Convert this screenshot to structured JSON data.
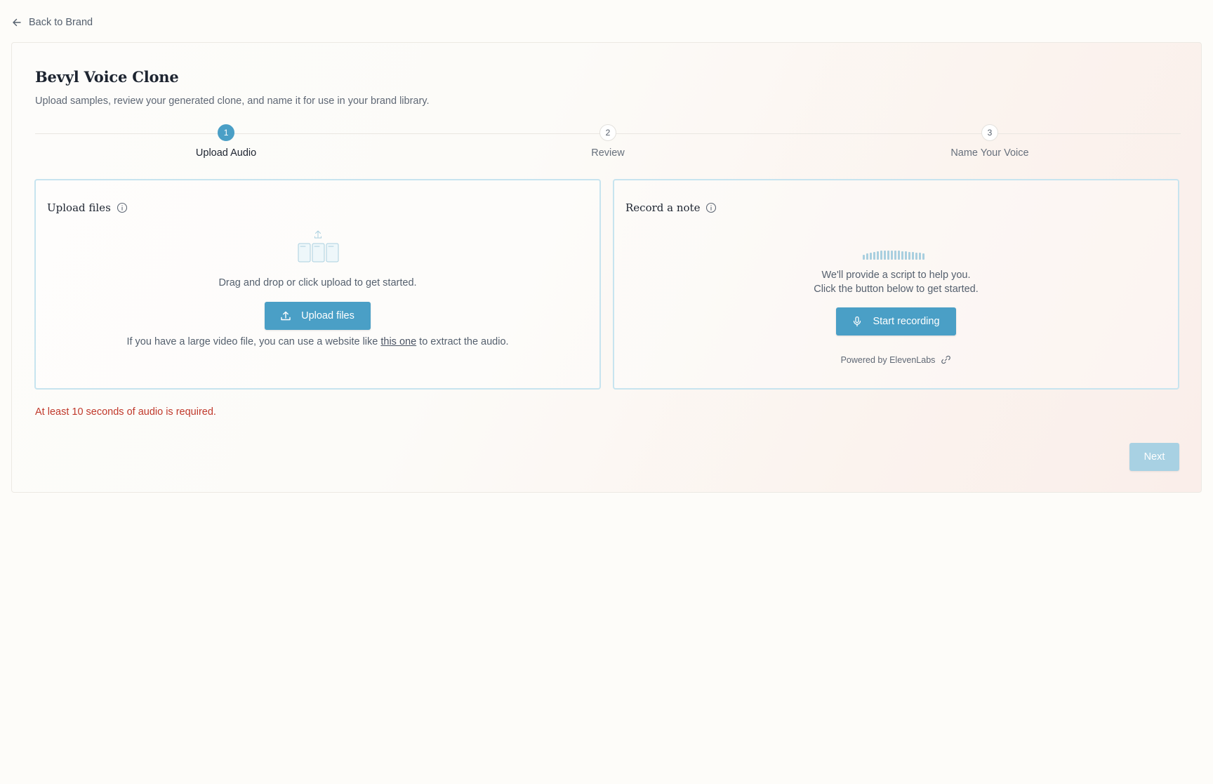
{
  "nav": {
    "back_label": "Back to Brand"
  },
  "page": {
    "title": "Bevyl Voice Clone",
    "subtitle": "Upload samples, review your generated clone, and name it for use in your brand library."
  },
  "stepper": {
    "steps": [
      {
        "number": "1",
        "label": "Upload Audio",
        "active": true
      },
      {
        "number": "2",
        "label": "Review",
        "active": false
      },
      {
        "number": "3",
        "label": "Name Your Voice",
        "active": false
      }
    ]
  },
  "upload_panel": {
    "title": "Upload files",
    "instruction": "Drag and drop or click upload to get started.",
    "button_label": "Upload files",
    "hint_before": "If you have a large video file, you can use a website like ",
    "hint_link": "this one",
    "hint_after": " to extract the audio."
  },
  "record_panel": {
    "title": "Record a note",
    "line1": "We'll provide a script to help you.",
    "line2": "Click the button below to get started.",
    "button_label": "Start recording",
    "powered_by": "Powered by ElevenLabs"
  },
  "error_message": "At least 10 seconds of audio is required.",
  "footer": {
    "next_label": "Next",
    "next_disabled": true
  },
  "icons": {
    "back": "arrow-left-icon",
    "info": "info-icon",
    "upload": "upload-icon",
    "mic": "microphone-icon",
    "link": "link-icon"
  },
  "colors": {
    "accent": "#4a9fc6",
    "accent_disabled": "#a8d1e3",
    "panel_border": "#c7e4ef",
    "error": "#c0392b"
  }
}
